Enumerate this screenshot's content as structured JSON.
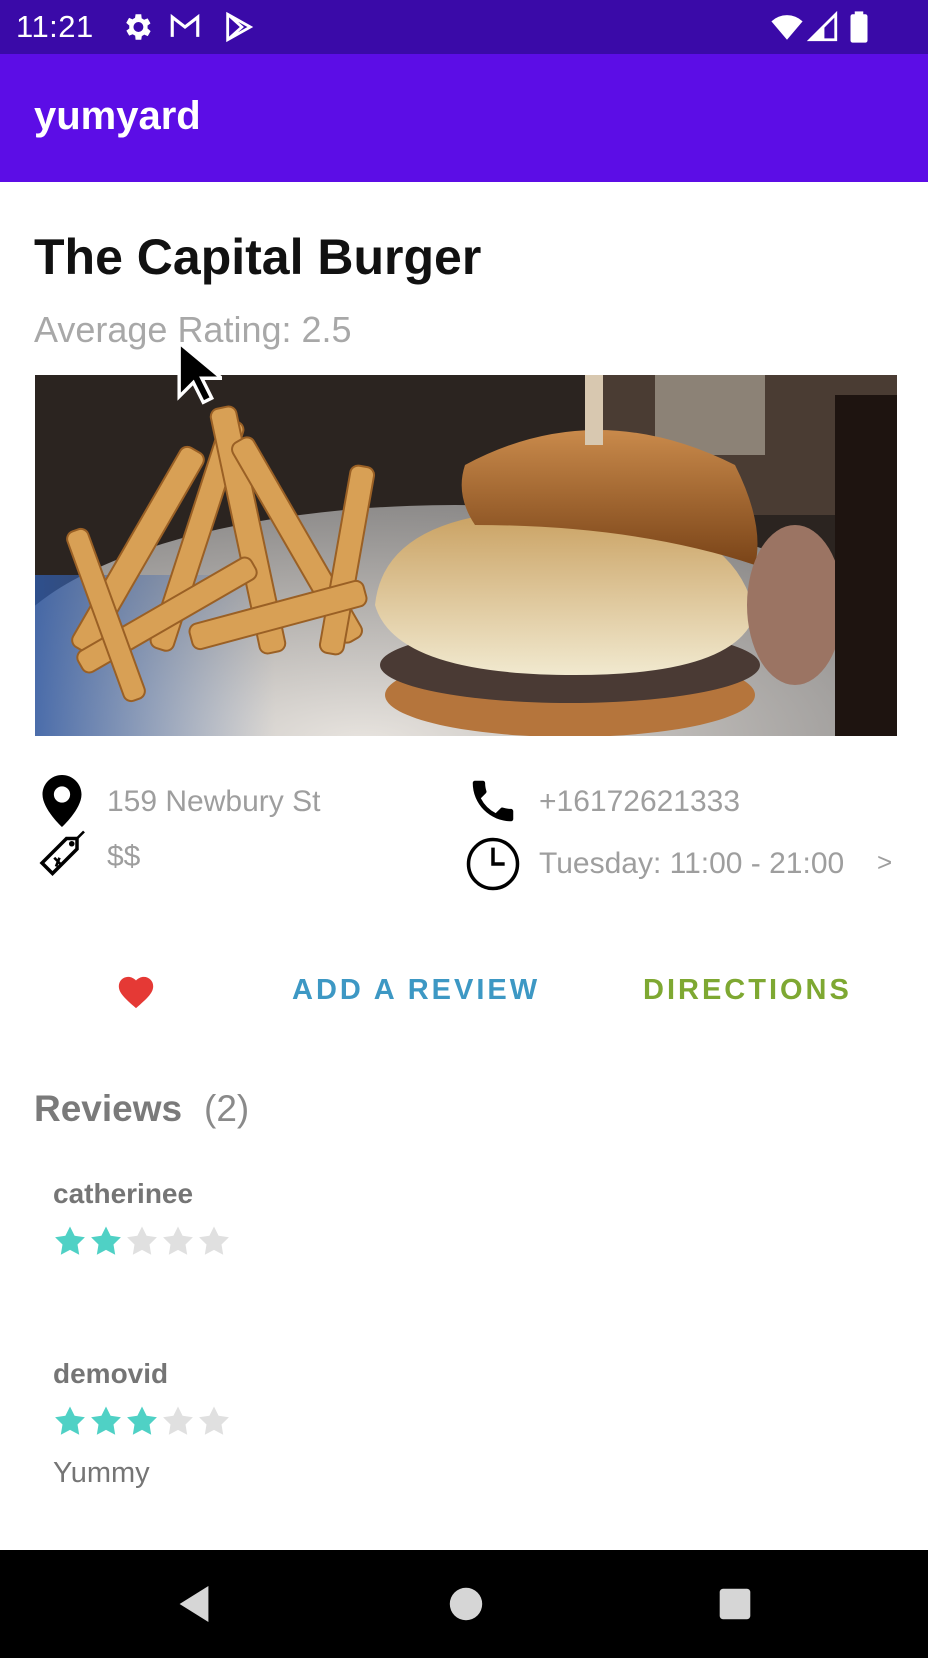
{
  "status_bar": {
    "time": "11:21",
    "icons": [
      "gear-icon",
      "gmail-icon",
      "play-store-icon",
      "wifi-icon",
      "signal-icon",
      "battery-icon"
    ]
  },
  "app_bar": {
    "title": "yumyard"
  },
  "restaurant": {
    "name": "The Capital Burger",
    "average_rating": "Average Rating: 2.5",
    "address": "159 Newbury St",
    "price": "$$",
    "phone": "+16172621333",
    "hours": "Tuesday: 11:00 - 21:00",
    "hours_more": ">"
  },
  "actions": {
    "favorite_icon": "heart-icon",
    "add_review": "ADD A REVIEW",
    "directions": "DIRECTIONS"
  },
  "reviews": {
    "title": "Reviews",
    "count": "(2)",
    "items": [
      {
        "user": "catherinee",
        "rating": 2,
        "max": 5,
        "text": ""
      },
      {
        "user": "demovid",
        "rating": 3,
        "max": 5,
        "text": "Yummy"
      }
    ]
  },
  "colors": {
    "status_bar": "#3a0aa8",
    "app_bar": "#5c0de6",
    "add_review": "#3d98c4",
    "directions": "#7ea832",
    "heart": "#e53935",
    "star_filled": "#4fd1c5",
    "star_empty": "#e0e0e0"
  }
}
